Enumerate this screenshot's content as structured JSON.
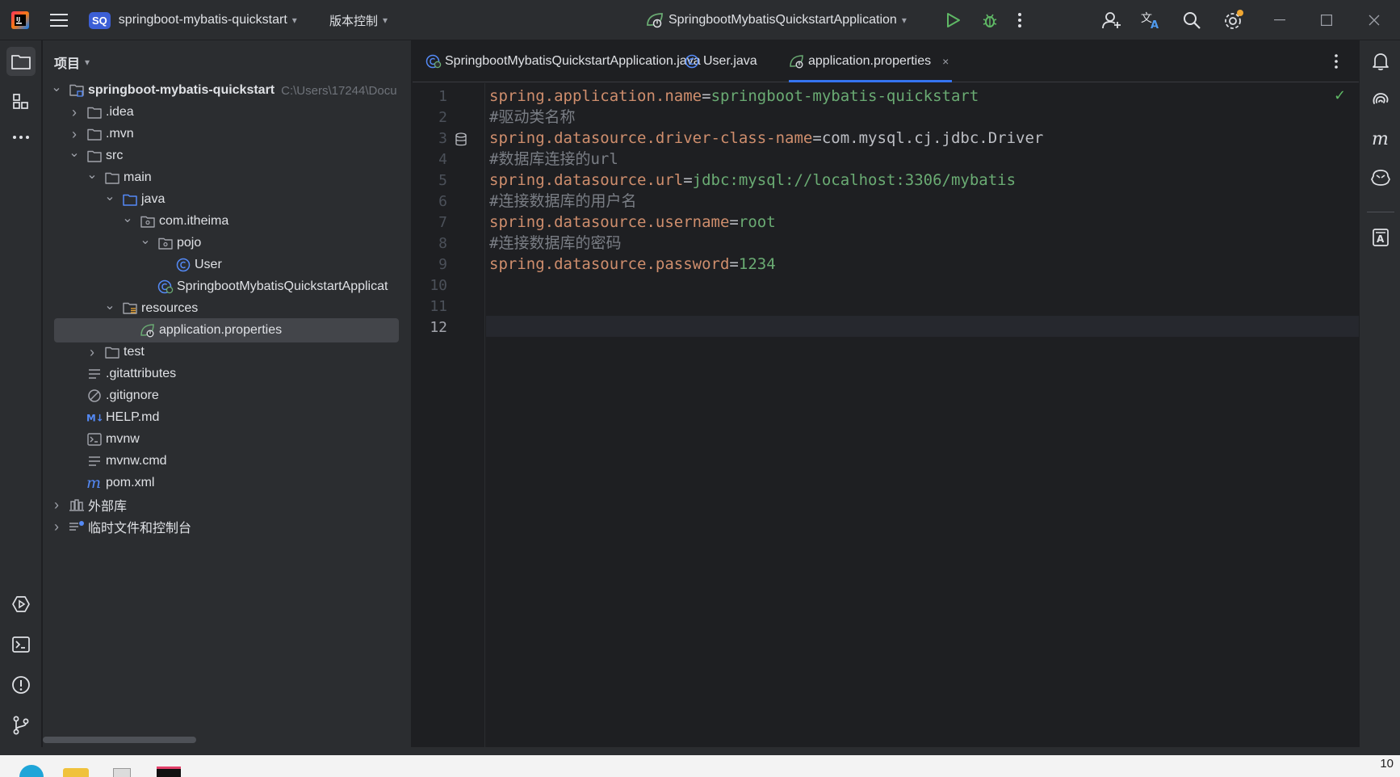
{
  "titlebar": {
    "project_badge": "SQ",
    "project_name": "springboot-mybatis-quickstart",
    "vcs_label": "版本控制",
    "run_config": "SpringbootMybatisQuickstartApplication"
  },
  "project_panel": {
    "title": "项目",
    "tree": [
      {
        "label": "springboot-mybatis-quickstart",
        "hint": "C:\\Users\\17244\\Docu",
        "depth": 0,
        "twisty": "open",
        "icon": "module-folder-icon",
        "bold": true
      },
      {
        "label": ".idea",
        "depth": 1,
        "twisty": "closed",
        "icon": "folder-icon"
      },
      {
        "label": ".mvn",
        "depth": 1,
        "twisty": "closed",
        "icon": "folder-icon"
      },
      {
        "label": "src",
        "depth": 1,
        "twisty": "open",
        "icon": "folder-icon"
      },
      {
        "label": "main",
        "depth": 2,
        "twisty": "open",
        "icon": "folder-icon"
      },
      {
        "label": "java",
        "depth": 3,
        "twisty": "open",
        "icon": "source-folder-icon"
      },
      {
        "label": "com.itheima",
        "depth": 4,
        "twisty": "open",
        "icon": "package-icon"
      },
      {
        "label": "pojo",
        "depth": 5,
        "twisty": "open",
        "icon": "package-icon"
      },
      {
        "label": "User",
        "depth": 6,
        "twisty": "none",
        "icon": "class-icon"
      },
      {
        "label": "SpringbootMybatisQuickstartApplicat",
        "depth": 5,
        "twisty": "none",
        "icon": "spring-class-icon"
      },
      {
        "label": "resources",
        "depth": 3,
        "twisty": "open",
        "icon": "resources-folder-icon"
      },
      {
        "label": "application.properties",
        "depth": 4,
        "twisty": "none",
        "icon": "spring-properties-icon",
        "selected": true
      },
      {
        "label": "test",
        "depth": 2,
        "twisty": "closed",
        "icon": "folder-icon"
      },
      {
        "label": ".gitattributes",
        "depth": 1,
        "twisty": "none",
        "icon": "text-file-icon"
      },
      {
        "label": ".gitignore",
        "depth": 1,
        "twisty": "none",
        "icon": "ignore-file-icon"
      },
      {
        "label": "HELP.md",
        "depth": 1,
        "twisty": "none",
        "icon": "markdown-icon"
      },
      {
        "label": "mvnw",
        "depth": 1,
        "twisty": "none",
        "icon": "shell-script-icon"
      },
      {
        "label": "mvnw.cmd",
        "depth": 1,
        "twisty": "none",
        "icon": "text-file-icon"
      },
      {
        "label": "pom.xml",
        "depth": 1,
        "twisty": "none",
        "icon": "maven-icon"
      },
      {
        "label": "外部库",
        "depth": 0,
        "twisty": "closed",
        "icon": "library-icon"
      },
      {
        "label": "临时文件和控制台",
        "depth": 0,
        "twisty": "closed",
        "icon": "scratches-icon"
      }
    ]
  },
  "editor": {
    "tabs": [
      {
        "label": "SpringbootMybatisQuickstartApplication.java",
        "icon": "spring-class-icon",
        "active": false
      },
      {
        "label": "User.java",
        "icon": "class-icon",
        "active": false
      },
      {
        "label": "application.properties",
        "icon": "spring-properties-icon",
        "active": true
      }
    ],
    "tab_close": "×",
    "current_line": 12,
    "lines": [
      {
        "n": "1",
        "key": "spring.application.name",
        "eq": "=",
        "val": "springboot-mybatis-quickstart",
        "vtype": "v"
      },
      {
        "n": "2",
        "comment": "#驱动类名称"
      },
      {
        "n": "3",
        "key": "spring.datasource.driver-class-name",
        "eq": "=",
        "val": "com.mysql.cj.jdbc.Driver",
        "vtype": "vp"
      },
      {
        "n": "4",
        "comment": "#数据库连接的url"
      },
      {
        "n": "5",
        "key": "spring.datasource.url",
        "eq": "=",
        "val": "jdbc:mysql://localhost:3306/mybatis",
        "vtype": "v"
      },
      {
        "n": "6",
        "comment": "#连接数据库的用户名"
      },
      {
        "n": "7",
        "key": "spring.datasource.username",
        "eq": "=",
        "val": "root",
        "vtype": "v"
      },
      {
        "n": "8",
        "comment": "#连接数据库的密码"
      },
      {
        "n": "9",
        "key": "spring.datasource.password",
        "eq": "=",
        "val": "1234",
        "vtype": "v"
      },
      {
        "n": "10"
      },
      {
        "n": "11"
      },
      {
        "n": "12"
      }
    ],
    "inspection_status": "✓"
  },
  "taskbar": {
    "clock": "10"
  },
  "colors": {
    "accent": "#3574f0",
    "keyword": "#cf8e6d",
    "string": "#6aab73",
    "comment": "#7a7e85",
    "run_green": "#5fb865"
  }
}
